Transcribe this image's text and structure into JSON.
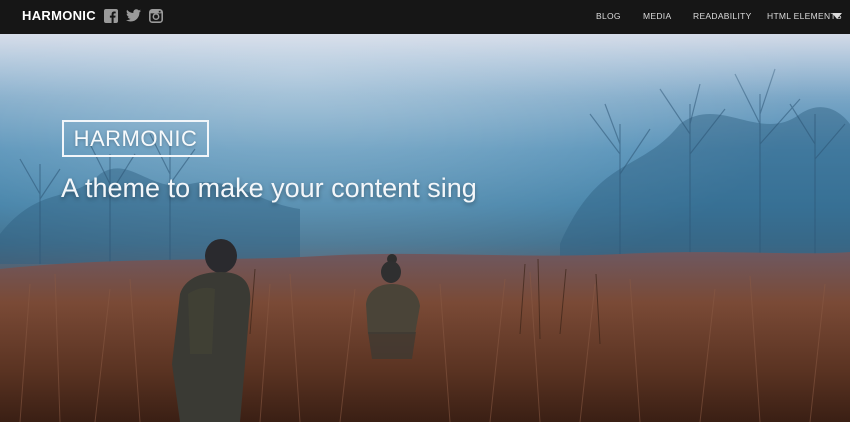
{
  "header": {
    "brand": "HARMONIC",
    "social": [
      {
        "name": "facebook-icon"
      },
      {
        "name": "twitter-icon"
      },
      {
        "name": "instagram-icon"
      }
    ],
    "nav": {
      "blog": "BLOG",
      "media": "MEDIA",
      "readability": "READABILITY",
      "html_elements": "HTML ELEMENTS"
    }
  },
  "hero": {
    "logo_text": "HARMONIC",
    "tagline": "A theme to make your content sing"
  },
  "colors": {
    "topbar": "#161616",
    "text": "#ffffff",
    "nav_text": "#dcdcdc",
    "sky_top": "#c9d2e2",
    "fog_blue": "#4f8db5",
    "field_brown": "#5f3a2a"
  }
}
